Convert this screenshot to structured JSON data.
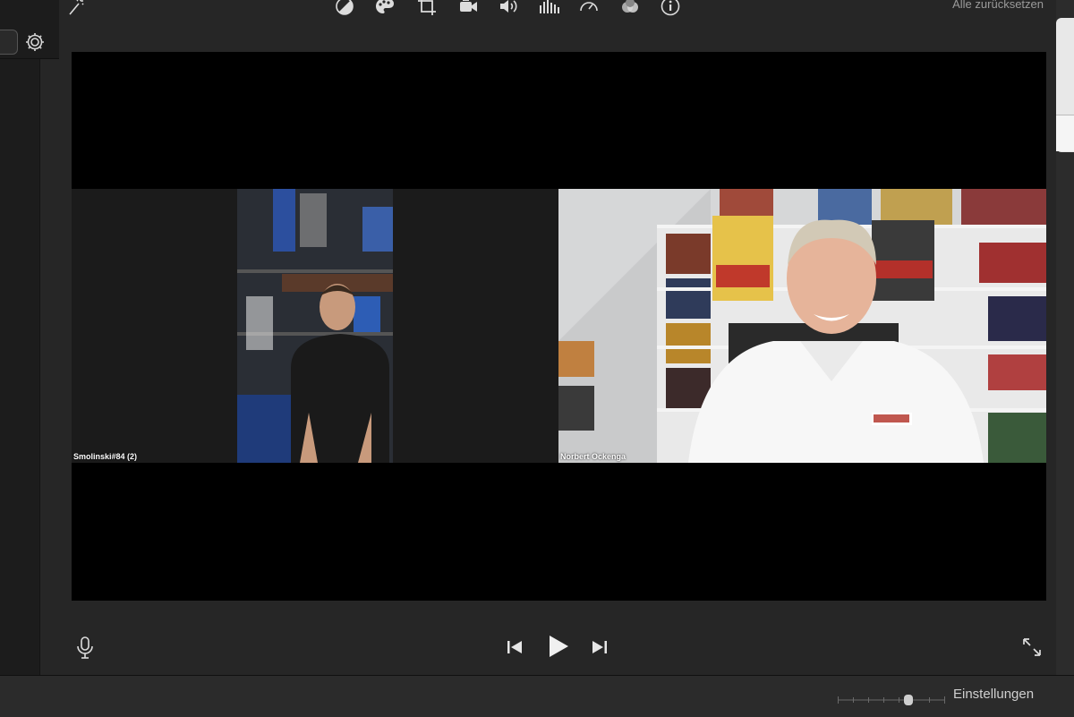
{
  "toolbar": {
    "reset_label": "Alle zurücksetzen"
  },
  "video": {
    "participants": [
      {
        "name": "Smolinski#84 (2)"
      },
      {
        "name": "Norbert Ockenga"
      }
    ]
  },
  "bottom": {
    "settings_label": "Einstellungen"
  },
  "colors": {
    "background": "#262626",
    "video_bg": "#000000",
    "icon": "#dcdcdc"
  }
}
